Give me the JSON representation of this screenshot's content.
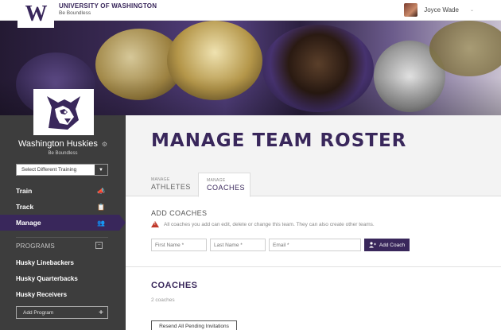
{
  "header": {
    "university_name": "UNIVERSITY OF WASHINGTON",
    "university_tagline": "Be Boundless",
    "logo_letter": "W",
    "user_name": "Joyce Wade",
    "user_caret": "⌄"
  },
  "sidebar": {
    "team_name": "Washington Huskies",
    "team_tagline": "Be Boundless",
    "settings_glyph": "⚙",
    "select_training_label": "Select Different Training",
    "select_caret": "▼",
    "nav": [
      {
        "label": "Train",
        "icon": "megaphone-icon",
        "glyph": "📣",
        "active": false
      },
      {
        "label": "Track",
        "icon": "clipboard-icon",
        "glyph": "📋",
        "active": false
      },
      {
        "label": "Manage",
        "icon": "users-icon",
        "glyph": "👥",
        "active": true
      }
    ],
    "programs_header": "PROGRAMS",
    "programs_collapse_glyph": "−",
    "programs": [
      "Husky Linebackers",
      "Husky Quarterbacks",
      "Husky Receivers"
    ],
    "add_program_label": "Add Program",
    "add_program_glyph": "+"
  },
  "main": {
    "page_title": "MANAGE TEAM ROSTER",
    "tabs": [
      {
        "small": "MANAGE",
        "label": "ATHLETES",
        "active": false
      },
      {
        "small": "MANAGE",
        "label": "COACHES",
        "active": true
      }
    ],
    "add_coaches_title": "ADD COACHES",
    "notice_text": "All coaches you add can edit, delete or change this team. They can also create other teams.",
    "first_name_placeholder": "First Name *",
    "last_name_placeholder": "Last Name *",
    "email_placeholder": "Email *",
    "add_coach_label": "Add Coach",
    "coaches_title": "COACHES",
    "coaches_count": "2 coaches",
    "resend_label": "Resend All Pending Invitations"
  },
  "colors": {
    "brand_purple": "#39275b",
    "sidebar_bg": "#3d3d3d",
    "warning_red": "#c0392b"
  }
}
